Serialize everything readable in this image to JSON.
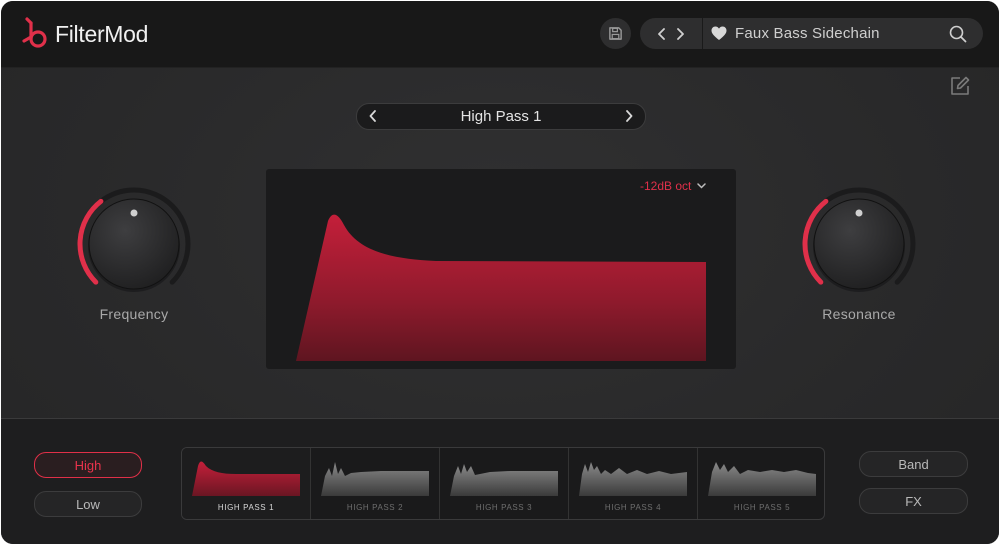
{
  "app": {
    "name": "FilterMod"
  },
  "header": {
    "preset_name": "Faux Bass Sidechain"
  },
  "filter": {
    "name": "High Pass 1",
    "slope": "-12dB oct"
  },
  "knobs": {
    "frequency": {
      "label": "Frequency",
      "value": 0.36
    },
    "resonance": {
      "label": "Resonance",
      "value": 0.36
    }
  },
  "mode_buttons": {
    "high": "High",
    "low": "Low"
  },
  "right_buttons": {
    "band": "Band",
    "fx": "FX"
  },
  "filter_types": [
    {
      "label": "HIGH PASS 1",
      "active": true
    },
    {
      "label": "HIGH PASS 2",
      "active": false
    },
    {
      "label": "HIGH PASS 3",
      "active": false
    },
    {
      "label": "HIGH PASS 4",
      "active": false
    },
    {
      "label": "HIGH PASS 5",
      "active": false
    }
  ],
  "colors": {
    "accent": "#e0304a",
    "panel": "#2a2a2b",
    "header": "#181818"
  },
  "icons": {
    "logo": "filtermod-logo",
    "save": "save-icon",
    "prev": "chevron-left-icon",
    "next": "chevron-right-icon",
    "favorite": "heart-icon",
    "search": "search-icon",
    "edit": "edit-icon",
    "dropdown": "chevron-down-icon"
  }
}
